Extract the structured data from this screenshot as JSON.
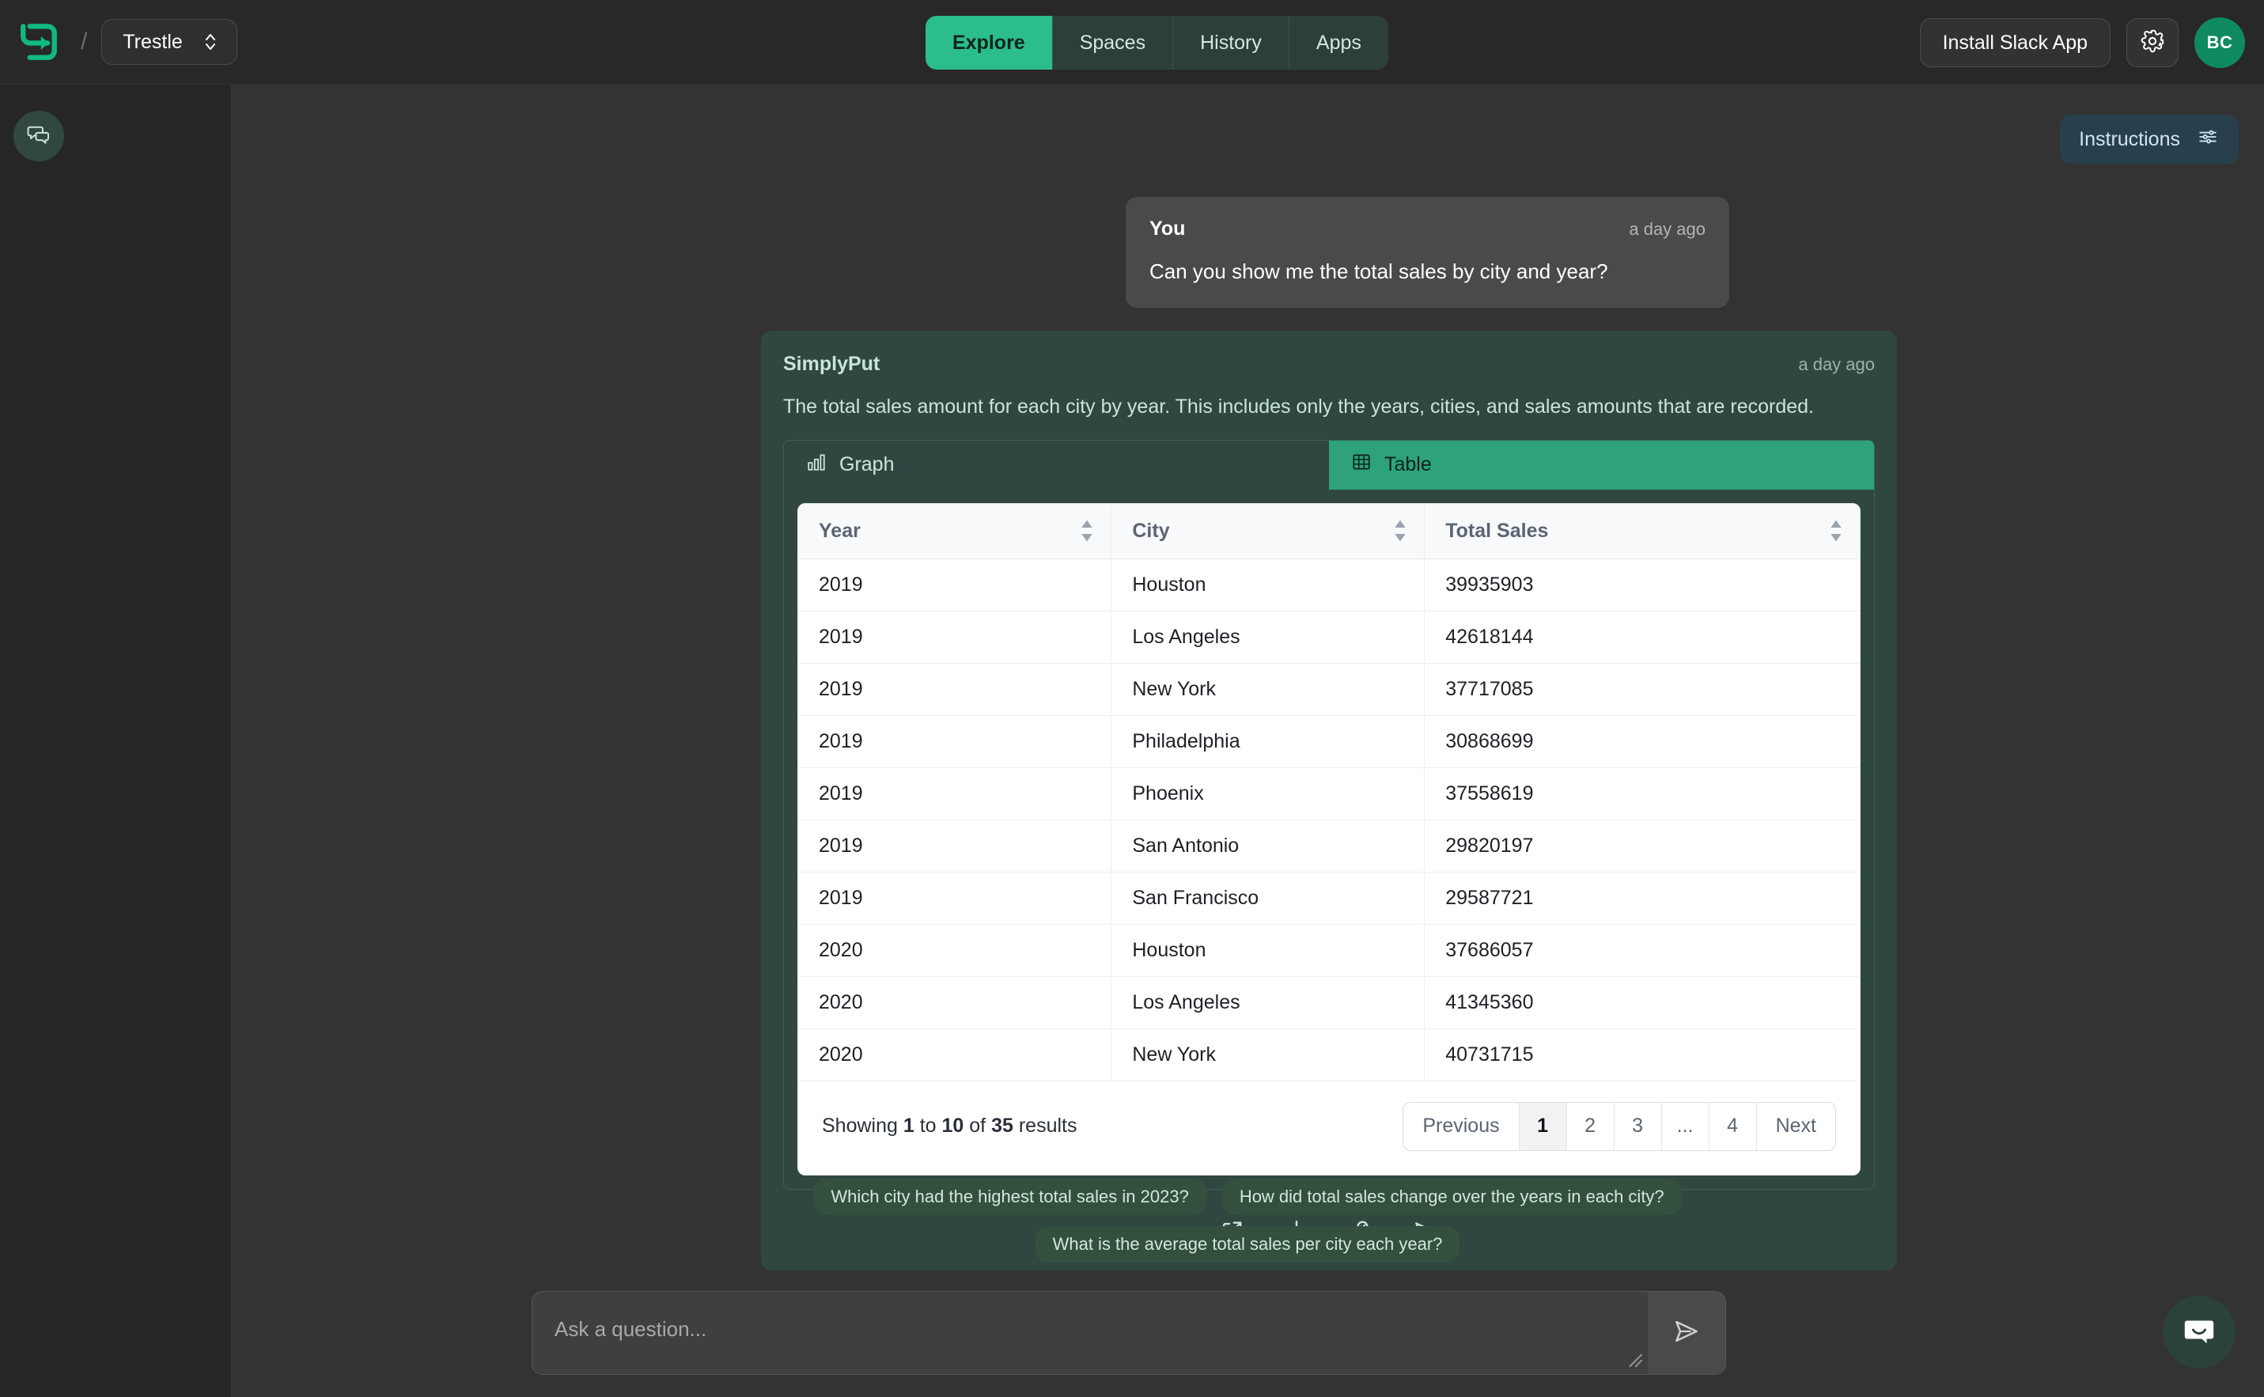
{
  "topbar": {
    "workspace": "Trestle",
    "separator": "/",
    "tabs": [
      {
        "label": "Explore",
        "active": true
      },
      {
        "label": "Spaces",
        "active": false
      },
      {
        "label": "History",
        "active": false
      },
      {
        "label": "Apps",
        "active": false
      }
    ],
    "slack_button": "Install Slack App",
    "avatar_initials": "BC"
  },
  "right_panel": {
    "instructions_label": "Instructions"
  },
  "conversation": {
    "user_message": {
      "author": "You",
      "time": "a day ago",
      "text": "Can you show me the total sales by city and year?"
    },
    "assistant_message": {
      "author": "SimplyPut",
      "time": "a day ago",
      "text": "The total sales amount for each city by year. This includes only the years, cities, and sales amounts that are recorded."
    }
  },
  "result_panel": {
    "tabs": [
      {
        "label": "Graph",
        "icon": "bar-chart-icon",
        "active": false
      },
      {
        "label": "Table",
        "icon": "table-icon",
        "active": true
      }
    ],
    "columns": [
      "Year",
      "City",
      "Total Sales"
    ],
    "rows": [
      [
        "2019",
        "Houston",
        "39935903"
      ],
      [
        "2019",
        "Los Angeles",
        "42618144"
      ],
      [
        "2019",
        "New York",
        "37717085"
      ],
      [
        "2019",
        "Philadelphia",
        "30868699"
      ],
      [
        "2019",
        "Phoenix",
        "37558619"
      ],
      [
        "2019",
        "San Antonio",
        "29820197"
      ],
      [
        "2019",
        "San Francisco",
        "29587721"
      ],
      [
        "2020",
        "Houston",
        "37686057"
      ],
      [
        "2020",
        "Los Angeles",
        "41345360"
      ],
      [
        "2020",
        "New York",
        "40731715"
      ]
    ],
    "pagination": {
      "showing_prefix": "Showing ",
      "from": "1",
      "mid_1": " to ",
      "to": "10",
      "mid_2": " of ",
      "total": "35",
      "suffix": " results",
      "previous": "Previous",
      "pages": [
        "1",
        "2",
        "3",
        "...",
        "4"
      ],
      "current_page": "1",
      "next": "Next"
    },
    "actions": [
      {
        "name": "open-external-icon"
      },
      {
        "name": "download-icon"
      },
      {
        "name": "verify-icon"
      },
      {
        "name": "schedule-send-icon"
      }
    ]
  },
  "suggestions": {
    "row1": [
      "Which city had the highest total sales in 2023?",
      "How did total sales change over the years in each city?"
    ],
    "row2": [
      "What is the average total sales per city each year?"
    ]
  },
  "composer": {
    "placeholder": "Ask a question...",
    "value": ""
  },
  "colors": {
    "accent_green": "#2bbd8c",
    "tab_active_green": "#2ea27c",
    "card_green": "#2f4740",
    "instructions_blue": "#28404d",
    "app_bg": "#333333",
    "rail_bg": "#262626"
  },
  "chart_data": {
    "type": "table",
    "title": "Total Sales by City and Year",
    "columns": [
      "Year",
      "City",
      "Total Sales"
    ],
    "rows": [
      [
        "2019",
        "Houston",
        39935903
      ],
      [
        "2019",
        "Los Angeles",
        42618144
      ],
      [
        "2019",
        "New York",
        37717085
      ],
      [
        "2019",
        "Philadelphia",
        30868699
      ],
      [
        "2019",
        "Phoenix",
        37558619
      ],
      [
        "2019",
        "San Antonio",
        29820197
      ],
      [
        "2019",
        "San Francisco",
        29587721
      ],
      [
        "2020",
        "Houston",
        37686057
      ],
      [
        "2020",
        "Los Angeles",
        41345360
      ],
      [
        "2020",
        "New York",
        40731715
      ]
    ],
    "total_rows": 35,
    "page": 1,
    "page_size": 10
  }
}
